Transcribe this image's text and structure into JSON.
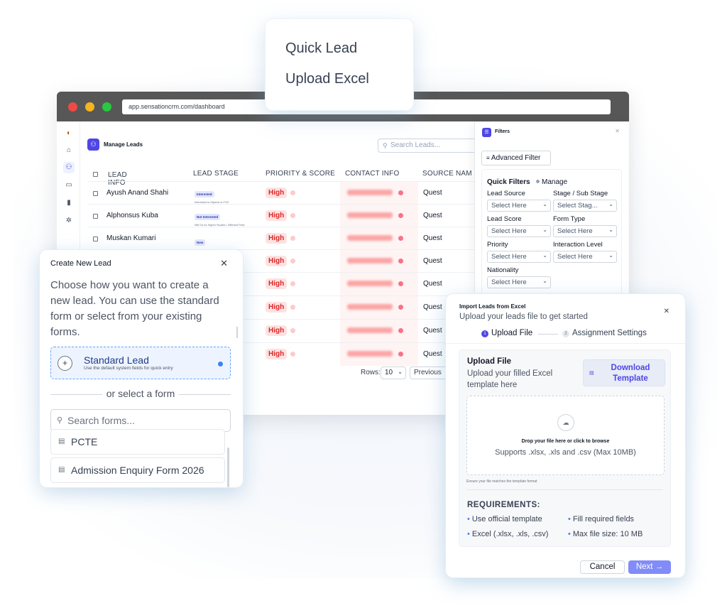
{
  "browser": {
    "url": "app.sensationcrm.com/dashboard",
    "traffic_colors": [
      "#ef4a45",
      "#f5b520",
      "#28c840"
    ]
  },
  "rail_icons": [
    "logo-icon",
    "home-icon",
    "leads-icon",
    "calendar-icon",
    "reports-icon",
    "settings-icon"
  ],
  "manage": {
    "title": "Manage Leads",
    "search_placeholder": "Search Leads...",
    "columns": [
      "LEAD INFO",
      "LEAD STAGE",
      "PRIORITY & SCORE",
      "CONTACT INFO",
      "SOURCE NAM"
    ],
    "rows": [
      {
        "name": "Ayush Anand Shahi",
        "stage": "Interested",
        "sub": "Interested to Stipend or FOC",
        "priority": "High",
        "source": "Quest"
      },
      {
        "name": "Alphonsus Kuba",
        "stage": "Not Interested",
        "sub": "Will Go for Higher Studies / Different Field",
        "priority": "High",
        "source": "Quest"
      },
      {
        "name": "Muskan Kumari",
        "stage": "New",
        "sub": "",
        "priority": "High",
        "source": "Quest"
      },
      {
        "name": "",
        "stage": "",
        "sub": "",
        "priority": "High",
        "source": "Quest"
      },
      {
        "name": "",
        "stage": "",
        "sub": "",
        "priority": "High",
        "source": "Quest"
      },
      {
        "name": "",
        "stage": "",
        "sub": "",
        "priority": "High",
        "source": "Quest"
      },
      {
        "name": "",
        "stage": "",
        "sub": "",
        "priority": "High",
        "source": "Quest"
      },
      {
        "name": "",
        "stage": "",
        "sub": "",
        "priority": "High",
        "source": "Quest"
      }
    ],
    "rows_label": "Rows:",
    "rows_value": "10",
    "previous_label": "Previous"
  },
  "filters": {
    "title": "Filters",
    "advanced_label": "Advanced Filter",
    "quick_title": "Quick Filters",
    "manage_label": "Manage",
    "fields": [
      {
        "label": "Lead Source",
        "value": "Select Here"
      },
      {
        "label": "Stage / Sub Stage",
        "value": "Select Stag..."
      },
      {
        "label": "Lead Score",
        "value": "Select Here"
      },
      {
        "label": "Form Type",
        "value": "Select Here"
      },
      {
        "label": "Priority",
        "value": "Select Here"
      },
      {
        "label": "Interaction Level",
        "value": "Select Here"
      },
      {
        "label": "Nationality",
        "value": "Select Here"
      }
    ]
  },
  "quick_menu": {
    "items": [
      "Quick Lead",
      "Upload Excel"
    ]
  },
  "create_lead": {
    "title": "Create New Lead",
    "description": "Choose how you want to create a new lead. You can use the standard form or select from your existing forms.",
    "standard_title": "Standard Lead",
    "standard_sub": "Use the default system fields for quick entry",
    "or_select": "or select a form",
    "search_placeholder": "Search forms...",
    "forms": [
      "PCTE",
      "Admission Enquiry Form 2026"
    ]
  },
  "import": {
    "title": "Import Leads from Excel",
    "subtitle": "Upload your leads file to get started",
    "steps": [
      {
        "num": "1",
        "label": "Upload File"
      },
      {
        "num": "2",
        "label": "Assignment Settings"
      }
    ],
    "upload_title": "Upload File",
    "upload_sub": "Upload your filled Excel template here",
    "download_label": "Download Template",
    "drop_text": "Drop your file here or click to browse",
    "supports": "Supports .xlsx, .xls and .csv (Max 10MB)",
    "ensure": "Ensure your file matches the template format",
    "requirements_title": "REQUIREMENTS:",
    "requirements": [
      "Use official template",
      "Fill required fields",
      "Excel (.xlsx, .xls, .csv)",
      "Max file size: 10 MB"
    ],
    "cancel_label": "Cancel",
    "next_label": "Next →"
  },
  "colors": {
    "accent": "#4f46e5",
    "priority_high": "#dc2626",
    "selection": "#3b82f6"
  }
}
